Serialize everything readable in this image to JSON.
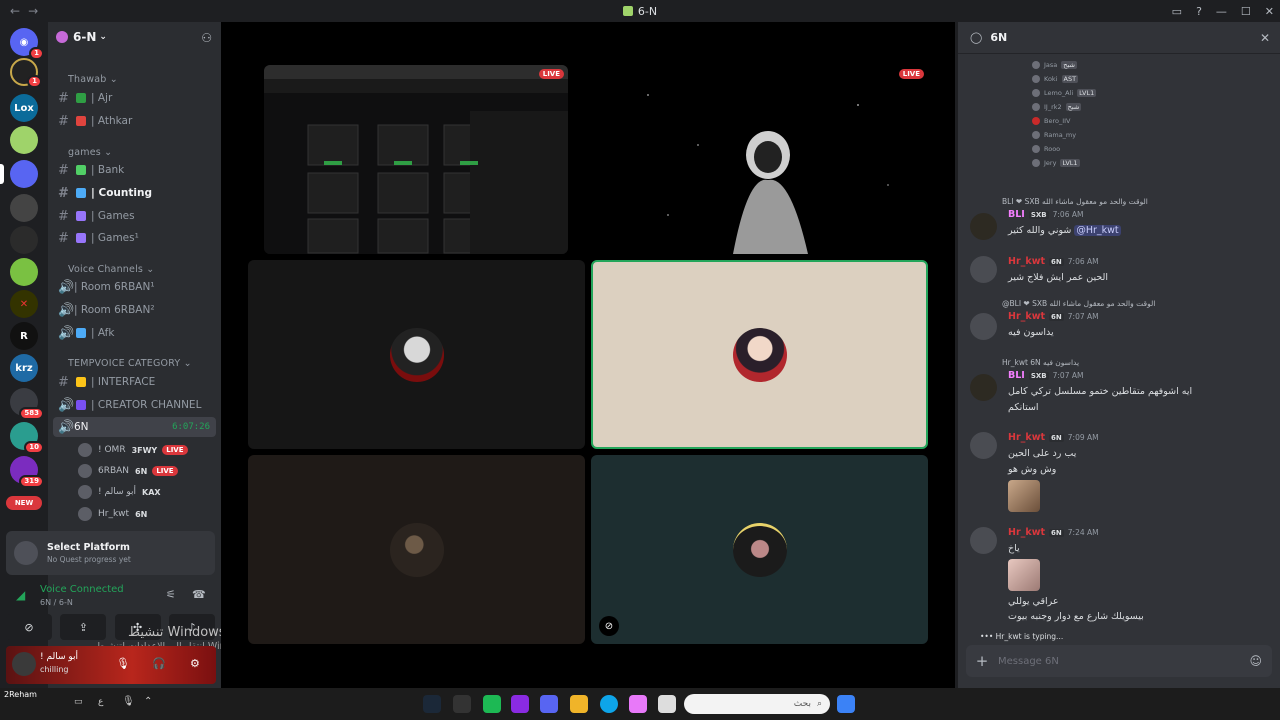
{
  "window": {
    "title": "6-N"
  },
  "guild_badges": {
    "g1": "1",
    "g2": "1",
    "g3": "583",
    "g4": "10",
    "g5": "319",
    "new": "NEW"
  },
  "guild_labels": {
    "lox": "Lox",
    "r": "R",
    "krz": "krz"
  },
  "server": {
    "name": "6-N"
  },
  "categories": {
    "thawab": "Thawab",
    "games": "games",
    "voice": "Voice Channels",
    "tempvoice": "TEMPVOICE CATEGORY"
  },
  "channels": {
    "ajr": "| Ajr",
    "athkar": "| Athkar",
    "bank": "| Bank",
    "counting": "| Counting",
    "games": "| Games",
    "games2": "| Games¹",
    "room1": "| Room 6RBAN¹",
    "room2": "| Room 6RBAN²",
    "afk": "| Afk",
    "interface": "| INTERFACE",
    "creator": "| CREATOR CHANNEL",
    "voice_active": "6N",
    "timer": "6:07:26"
  },
  "voice_users": [
    {
      "name": "! OMR",
      "tag": "3FWY",
      "live": "LIVE"
    },
    {
      "name": "6RBAN",
      "tag": "6N",
      "live": "LIVE"
    },
    {
      "name": "! أبو سالم",
      "tag": "KAX",
      "live": ""
    },
    {
      "name": "Hr_kwt",
      "tag": "6N",
      "live": ""
    }
  ],
  "quest": {
    "title": "Select Platform",
    "sub": "No Quest progress yet"
  },
  "voice_connection": {
    "status": "Voice Connected",
    "channel": "6N / 6-N"
  },
  "user_panel": {
    "name": "! أبو سالم",
    "status": "chilling"
  },
  "watermark": {
    "line1": "تنشيط Windows",
    "line2": "انتقل إلى الإعدادات لتنشيط Windows."
  },
  "stage": {
    "live": "LIVE"
  },
  "thread": {
    "title": "6N",
    "composer_placeholder": "Message 6N",
    "typing": "Hr_kwt is typing..."
  },
  "member_list_mini": [
    {
      "name": "Jasa",
      "badge": "شبح"
    },
    {
      "name": "Koki",
      "badge": "AST"
    },
    {
      "name": "Lemo_Ali",
      "badge": "LVL1"
    },
    {
      "name": "IJ_rk2",
      "badge": "شبح"
    },
    {
      "name": "Bero_IIV",
      "badge": ""
    },
    {
      "name": "Rama_my",
      "badge": ""
    },
    {
      "name": "Rooo",
      "badge": ""
    },
    {
      "name": "Jery",
      "badge": "LVL1"
    }
  ],
  "messages": [
    {
      "reply": "BLI ❤ SXB الوقت والحد مو معقول ماشاء الله",
      "name": "BLI",
      "tag": "SXB",
      "time": "7:06 AM",
      "body": "شوني والله كثير",
      "mention": "@Hr_kwt"
    },
    {
      "reply": "",
      "name": "Hr_kwt",
      "tag": "6N",
      "time": "7:06 AM",
      "body": "الحين عمر ايش فلاج شير",
      "mention": ""
    },
    {
      "reply": "@BLI ❤ SXB الوقت والحد مو معقول ماشاء الله",
      "name": "Hr_kwt",
      "tag": "6N",
      "time": "7:07 AM",
      "body": "يداسون فيه",
      "mention": ""
    },
    {
      "reply": "Hr_kwt 6N يداسون فيه",
      "name": "BLI",
      "tag": "SXB",
      "time": "7:07 AM",
      "body": "ايه اشوفهم متقاطين ختمو مسلسل تركي كامل",
      "body2": "استانكم",
      "mention": ""
    },
    {
      "reply": "",
      "name": "Hr_kwt",
      "tag": "6N",
      "time": "7:09 AM",
      "body": "يب رد على الحين",
      "body2": "وش وش هو",
      "mention": ""
    },
    {
      "reply": "",
      "name": "Hr_kwt",
      "tag": "6N",
      "time": "7:24 AM",
      "body": "ياخ",
      "body2": "عراقي يوللي",
      "body3": "بيسويلك شارع مع دوار وجنبه بيوت",
      "mention": ""
    }
  ],
  "taskbar": {
    "search": "بحث",
    "user": "2Reham",
    "lang": "ع"
  },
  "colors": {
    "accent": "#5865f2",
    "green": "#23a55a",
    "red": "#da373c",
    "bli": "#f47fff",
    "hr": "#da373c"
  }
}
